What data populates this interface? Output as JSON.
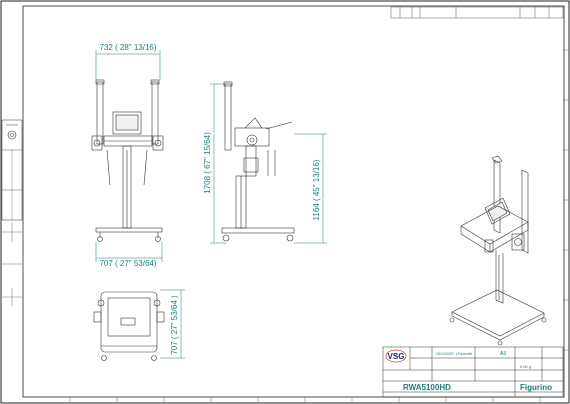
{
  "dimensions": {
    "front_width": "732 ( 28\" 13/16)",
    "front_base_width": "707 ( 27\" 53/64)",
    "side_height_total": "1708 ( 67\" 15/64)",
    "side_height_body": "1164 ( 45\" 13/16)",
    "top_depth": "707 ( 27\" 53/64 )"
  },
  "title_block": {
    "logo": "VSG",
    "model": "RWA5100HD",
    "sheet_name": "Figurino",
    "date": "08/10/2020",
    "drawn_by": "LFacchetti",
    "format": "A3",
    "weight": "0,00 g"
  },
  "colors": {
    "line": "#333333",
    "dimension": "#1f7c7c",
    "frame": "#222222"
  }
}
